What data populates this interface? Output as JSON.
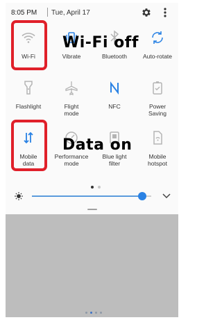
{
  "status_bar": {
    "time": "8:05 PM",
    "date": "Tue, April 17"
  },
  "tiles": [
    {
      "label": "Wi-Fi",
      "icon": "wifi-icon",
      "state": "off"
    },
    {
      "label": "Vibrate",
      "icon": "vibrate-icon",
      "state": "on"
    },
    {
      "label": "Bluetooth",
      "icon": "bluetooth-icon",
      "state": "off"
    },
    {
      "label": "Auto-rotate",
      "icon": "auto-rotate-icon",
      "state": "on"
    },
    {
      "label": "Flashlight",
      "icon": "flashlight-icon",
      "state": "off"
    },
    {
      "label": "Flight\nmode",
      "icon": "airplane-icon",
      "state": "off"
    },
    {
      "label": "NFC",
      "icon": "nfc-icon",
      "state": "on"
    },
    {
      "label": "Power\nSaving",
      "icon": "battery-icon",
      "state": "off"
    },
    {
      "label": "Mobile\ndata",
      "icon": "mobile-data-icon",
      "state": "on"
    },
    {
      "label": "Performance\nmode",
      "icon": "performance-icon",
      "state": "off"
    },
    {
      "label": "Blue light\nfilter",
      "icon": "blue-light-icon",
      "state": "off"
    },
    {
      "label": "Mobile\nhotspot",
      "icon": "hotspot-icon",
      "state": "off"
    }
  ],
  "annotations": {
    "wifi": "Wi-Fi off",
    "data": "Data on"
  },
  "brightness": {
    "level": 0.88
  },
  "colors": {
    "active": "#2a82e4",
    "inactive": "#b4b4b4",
    "highlight": "#e0202a",
    "shade": "#bdbdbd"
  }
}
